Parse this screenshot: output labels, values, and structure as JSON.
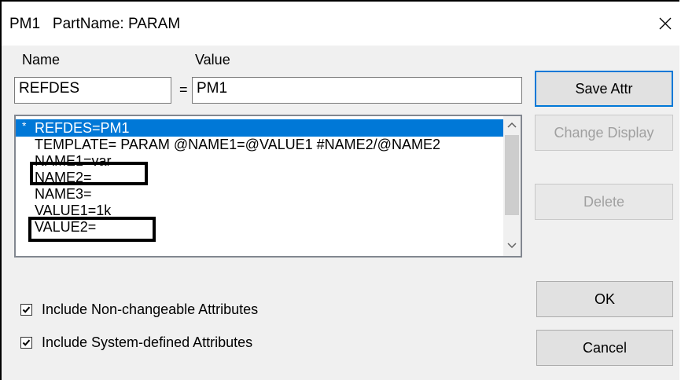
{
  "window": {
    "title": "PM1   PartName: PARAM",
    "close_icon": "close-icon"
  },
  "form": {
    "name_label": "Name",
    "value_label": "Value",
    "name_value": "REFDES",
    "equals": "=",
    "value_value": "PM1"
  },
  "list": {
    "items": [
      {
        "marker": "*",
        "text": "REFDES=PM1",
        "selected": true
      },
      {
        "marker": "",
        "text": "TEMPLATE= PARAM @NAME1=@VALUE1 #NAME2/@NAME2",
        "selected": false
      },
      {
        "marker": "",
        "text": "NAME1=var",
        "selected": false
      },
      {
        "marker": "",
        "text": "NAME2=",
        "selected": false
      },
      {
        "marker": "",
        "text": "NAME3=",
        "selected": false
      },
      {
        "marker": "",
        "text": "VALUE1=1k",
        "selected": false
      },
      {
        "marker": "",
        "text": "VALUE2=",
        "selected": false
      }
    ],
    "scroll_up_icon": "chevron-up-icon",
    "scroll_down_icon": "chevron-down-icon"
  },
  "buttons": {
    "save_attr": "Save Attr",
    "change_display": "Change Display",
    "delete": "Delete",
    "ok": "OK",
    "cancel": "Cancel"
  },
  "options": {
    "include_non_changeable": {
      "label": "Include Non-changeable Attributes",
      "checked": true
    },
    "include_system_defined": {
      "label": "Include System-defined Attributes",
      "checked": true
    }
  },
  "colors": {
    "selection": "#0078d7",
    "highlight_box": "#000000"
  }
}
